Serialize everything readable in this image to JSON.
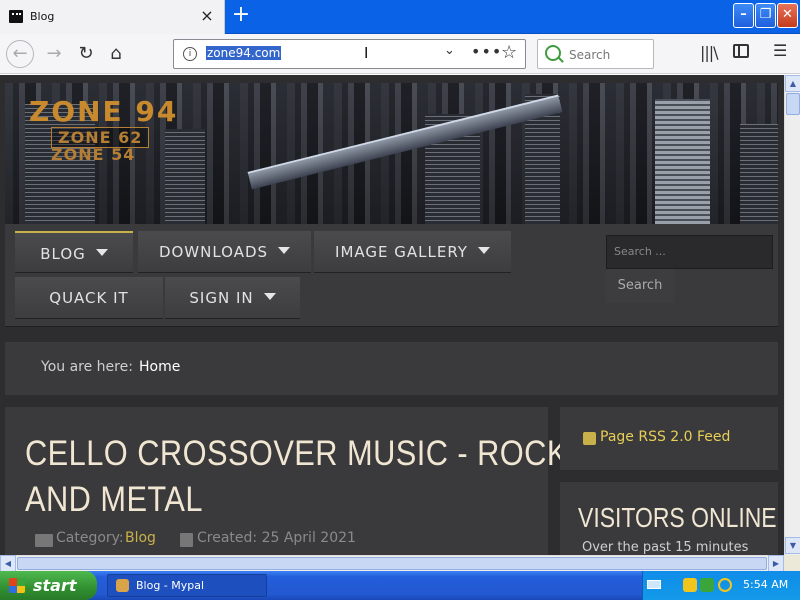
{
  "browser": {
    "tab_title": "Blog",
    "tab_close": "×",
    "new_tab": "+",
    "url": "zone94.com",
    "search_placeholder": "Search",
    "window_controls": {
      "minimize": "–",
      "maximize": "❐",
      "close": "✕"
    }
  },
  "site": {
    "logo": {
      "line1": "ZONE 94",
      "line2": "ZONE 62",
      "line3": "ZONE 54"
    },
    "menu": [
      {
        "label": "BLOG",
        "dropdown": true,
        "active": true
      },
      {
        "label": "DOWNLOADS",
        "dropdown": true
      },
      {
        "label": "IMAGE GALLERY",
        "dropdown": true
      },
      {
        "label": "QUACK IT",
        "dropdown": false
      },
      {
        "label": "SIGN IN",
        "dropdown": true
      }
    ],
    "search": {
      "placeholder": "Search ...",
      "button": "Search"
    },
    "breadcrumb": {
      "label": "You are here:",
      "current": "Home"
    },
    "article": {
      "title_line1": "CELLO CROSSOVER MUSIC - ROCK",
      "title_line2": "AND METAL",
      "category_label": "Category:",
      "category": "Blog",
      "created": "Created: 25 April 2021"
    },
    "rss": "Page RSS 2.0 Feed",
    "visitors": {
      "title": "VISITORS ONLINE",
      "subtitle": "Over the past 15 minutes"
    }
  },
  "taskbar": {
    "start": "start",
    "window_label": "Blog - Mypal",
    "clock": "5:54 AM"
  },
  "colors": {
    "accent": "#c8b14a",
    "panel": "#3a3a3c",
    "page_bg": "#2d2d2f",
    "xp_blue": "#245edb"
  }
}
